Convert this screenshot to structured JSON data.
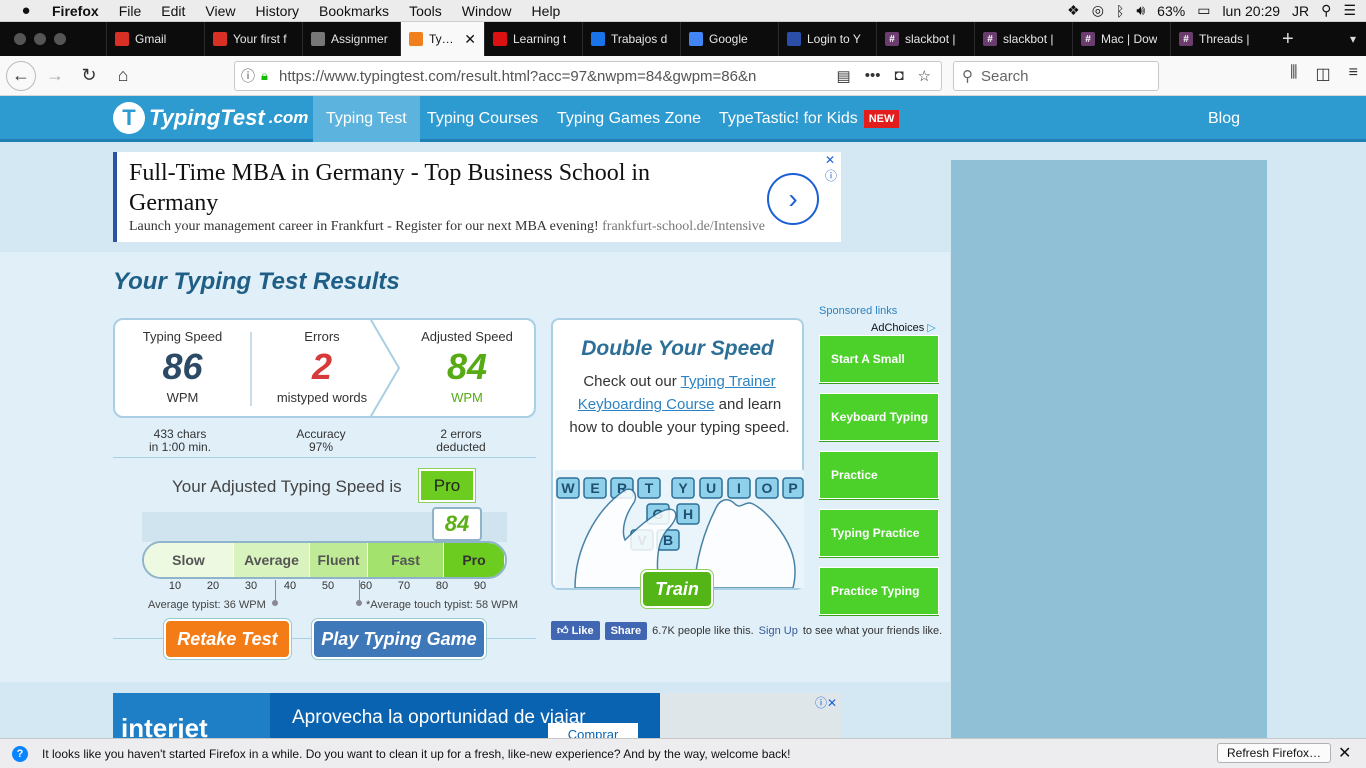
{
  "menubar": {
    "app": "Firefox",
    "items": [
      "File",
      "Edit",
      "View",
      "History",
      "Bookmarks",
      "Tools",
      "Window",
      "Help"
    ],
    "battery": "63%",
    "clock": "lun 20:29",
    "user": "JR"
  },
  "tabs": [
    {
      "label": "Gmail",
      "icon": "gmail-icon",
      "color": "#d93025"
    },
    {
      "label": "Your first f",
      "icon": "gmail-icon",
      "color": "#d93025"
    },
    {
      "label": "Assignmer",
      "icon": "doc-icon",
      "color": "#777777"
    },
    {
      "label": "Typing",
      "icon": "typingtest-icon",
      "color": "#f07f1e",
      "active": true
    },
    {
      "label": "Learning t",
      "icon": "red-icon",
      "color": "#d11"
    },
    {
      "label": "Trabajos d",
      "icon": "blue-icon",
      "color": "#1a73e8"
    },
    {
      "label": "Google",
      "icon": "google-icon",
      "color": "#4285f4"
    },
    {
      "label": "Login to Y",
      "icon": "shield-icon",
      "color": "#2b4fa8"
    },
    {
      "label": "slackbot |",
      "icon": "hash-icon",
      "color": "#6b3d6e"
    },
    {
      "label": "slackbot |",
      "icon": "hash-icon",
      "color": "#6b3d6e"
    },
    {
      "label": "Mac | Dow",
      "icon": "hash-icon",
      "color": "#6b3d6e"
    },
    {
      "label": "Threads |",
      "icon": "hash-icon",
      "color": "#6b3d6e"
    }
  ],
  "nav": {
    "url": "https://www.typingtest.com/result.html?acc=97&nwpm=84&gwpm=86&n",
    "search_placeholder": "Search"
  },
  "site": {
    "logo": "TypingTest",
    "logo_suffix": ".com",
    "nav": [
      "Typing Test",
      "Typing Courses",
      "Typing Games Zone",
      "TypeTastic! for Kids"
    ],
    "new_badge": "NEW",
    "blog": "Blog"
  },
  "topad": {
    "headline": "Full-Time MBA in Germany - Top Business School in Germany",
    "sub": "Launch your management career in Frankfurt - Register for our next MBA evening!",
    "domain": "frankfurt-school.de/Intensive"
  },
  "results": {
    "title": "Your Typing Test Results",
    "speed": {
      "label": "Typing Speed",
      "value": "86",
      "unit": "WPM",
      "detail1": "433 chars",
      "detail2": "in 1:00 min."
    },
    "errors": {
      "label": "Errors",
      "value": "2",
      "unit": "mistyped words",
      "detail1": "Accuracy",
      "detail2": "97%"
    },
    "adjusted": {
      "label": "Adjusted Speed",
      "value": "84",
      "unit": "WPM",
      "detail1": "2 errors",
      "detail2": "deducted"
    },
    "level_text": "Your Adjusted Typing Speed is",
    "level": "Pro",
    "score": "84",
    "gauge": [
      {
        "label": "Slow",
        "color": "#eef9e2"
      },
      {
        "label": "Average",
        "color": "#d9f3bf"
      },
      {
        "label": "Fluent",
        "color": "#bfeb96"
      },
      {
        "label": "Fast",
        "color": "#a3e26c"
      },
      {
        "label": "Pro",
        "color": "#6ccc1f"
      }
    ],
    "ticks": [
      "10",
      "20",
      "30",
      "40",
      "50",
      "60",
      "70",
      "80",
      "90"
    ],
    "note_avg": "Average typist: 36 WPM",
    "note_touch": "*Average touch typist: 58 WPM",
    "retake": "Retake Test",
    "play": "Play Typing Game"
  },
  "promo": {
    "title": "Double Your Speed",
    "text_before": "Check out our ",
    "link": "Typing Trainer Keyboarding Course",
    "text_after": " and learn how to double your typing speed.",
    "keys": [
      "W",
      "E",
      "R",
      "T",
      "Y",
      "U",
      "I",
      "O",
      "P",
      "G",
      "H",
      "V",
      "B"
    ],
    "train": "Train"
  },
  "sponsored": {
    "label": "Sponsored links",
    "adchoices": "AdChoices",
    "links": [
      "Start A Small",
      "Keyboard Typing",
      "Practice",
      "Typing Practice",
      "Practice Typing"
    ]
  },
  "facebook": {
    "like": "Like",
    "share": "Share",
    "count_text": "6.7K people like this.",
    "signup": "Sign Up",
    "after": "to see what your friends like."
  },
  "botad": {
    "brand": "interjet",
    "headline": "Aprovecha la oportunidad de viajar",
    "cta": "Comprar"
  },
  "notification": {
    "text": "It looks like you haven't started Firefox in a while. Do you want to clean it up for a fresh, like-new experience? And by the way, welcome back!",
    "button": "Refresh Firefox…"
  }
}
